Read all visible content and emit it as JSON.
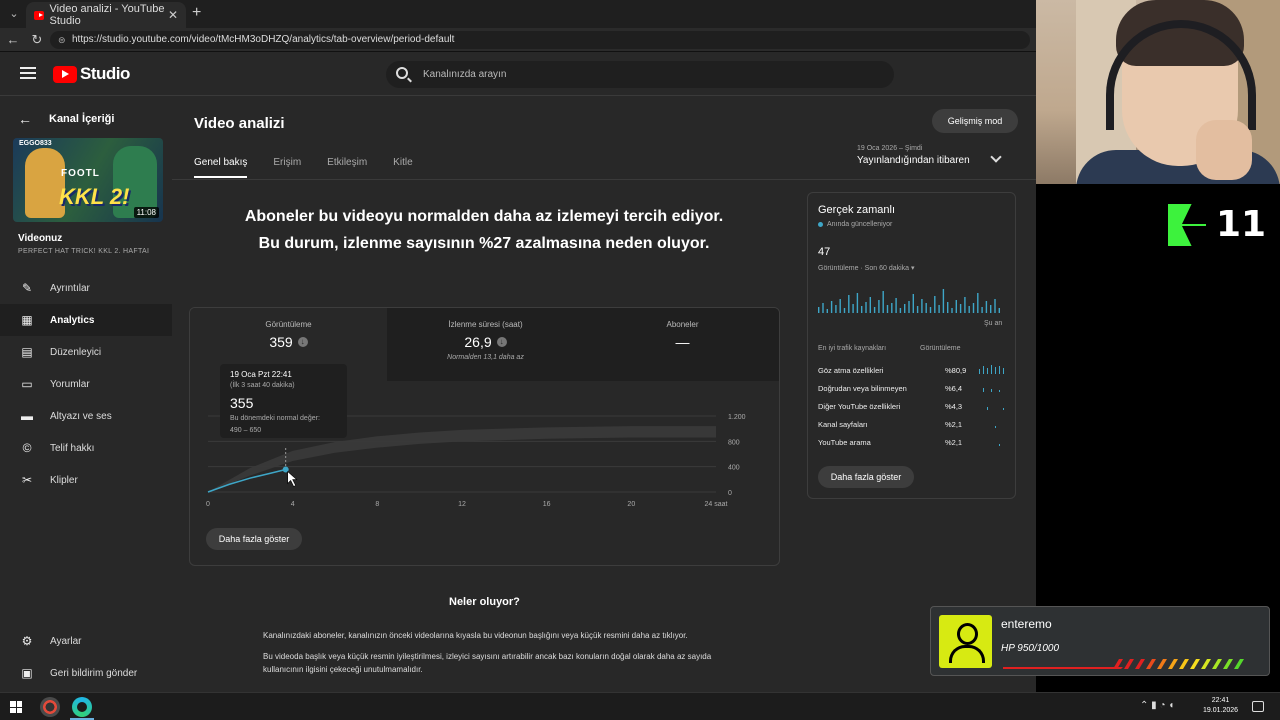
{
  "browser": {
    "tab_title": "Video analizi - YouTube Studio",
    "url": "https://studio.youtube.com/video/tMcHM3oDHZQ/analytics/tab-overview/period-default"
  },
  "studio": {
    "logo_text": "Studio",
    "search_placeholder": "Kanalınızda arayın"
  },
  "sidebar": {
    "back_label": "Kanal İçeriği",
    "thumb_duration": "11:08",
    "thumb_text": "KKL 2!",
    "thumb_top_text": "FOOTL",
    "thumb_badge": "EGGO833",
    "video_label": "Videonuz",
    "video_title": "PERFECT HAT TRICK! KKL 2. HAFTAI",
    "items": [
      {
        "label": "Ayrıntılar",
        "icon": "pencil-icon"
      },
      {
        "label": "Analytics",
        "icon": "analytics-icon"
      },
      {
        "label": "Düzenleyici",
        "icon": "editor-icon"
      },
      {
        "label": "Yorumlar",
        "icon": "comments-icon"
      },
      {
        "label": "Altyazı ve ses",
        "icon": "subtitles-icon"
      },
      {
        "label": "Telif hakkı",
        "icon": "copyright-icon"
      },
      {
        "label": "Klipler",
        "icon": "scissors-icon"
      }
    ],
    "bottom_items": [
      {
        "label": "Ayarlar",
        "icon": "gear-icon"
      },
      {
        "label": "Geri bildirim gönder",
        "icon": "feedback-icon"
      }
    ]
  },
  "main": {
    "title": "Video analizi",
    "advanced_button": "Gelişmiş mod",
    "tabs": [
      "Genel bakış",
      "Erişim",
      "Etkileşim",
      "Kitle"
    ],
    "period_date": "19 Oca 2026 – Şimdi",
    "period_label": "Yayınlandığından itibaren",
    "headline": "Aboneler bu videoyu normalden daha az izlemeyi tercih ediyor. Bu durum, izlenme sayısının %27 azalmasına neden oluyor.",
    "metrics": [
      {
        "label": "Görüntüleme",
        "value": "359",
        "sub": ""
      },
      {
        "label": "İzlenme süresi (saat)",
        "value": "26,9",
        "sub": "Normalden 13,1 daha az"
      },
      {
        "label": "Aboneler",
        "value": "—",
        "sub": ""
      }
    ],
    "tooltip": {
      "date": "19 Oca Pzt 22:41",
      "sub": "(İlk 3 saat 40 dakika)",
      "value": "355",
      "note": "Bu dönemdeki normal değer:",
      "range": "490 – 650"
    },
    "more_button": "Daha fazla göster",
    "whats_title": "Neler oluyor?",
    "para1": "Kanalınızdaki aboneler, kanalınızın önceki videolarına kıyasla bu videonun başlığını veya küçük resmini daha az tıklıyor.",
    "para2": "Bu videoda başlık veya küçük resmin iyileştirilmesi, izleyici sayısını artırabilir ancak bazı konuların doğal olarak daha az sayıda kullanıcının ilgisini çekeceği unutulmamalıdır."
  },
  "chart_data": {
    "type": "line",
    "x_ticks": [
      "0",
      "4",
      "8",
      "12",
      "16",
      "20",
      "24 saat"
    ],
    "y_ticks": [
      "0",
      "400",
      "800",
      "1.200"
    ],
    "ylim": [
      0,
      1200
    ],
    "xlim": [
      0,
      24
    ],
    "series": [
      {
        "values_x": [
          0,
          1,
          2,
          3,
          3.67
        ],
        "values_y": [
          0,
          120,
          220,
          300,
          355
        ]
      }
    ],
    "band": {
      "x": [
        0,
        2,
        4,
        6,
        8,
        10,
        12,
        14,
        16,
        18,
        20,
        22,
        24
      ],
      "low": [
        0,
        260,
        490,
        620,
        700,
        760,
        800,
        820,
        840,
        850,
        860,
        860,
        860
      ],
      "high": [
        0,
        380,
        650,
        790,
        880,
        940,
        980,
        1000,
        1020,
        1030,
        1040,
        1040,
        1040
      ]
    }
  },
  "realtime": {
    "title": "Gerçek zamanlı",
    "live_label": "Anında güncelleniyor",
    "count": "47",
    "count_label": "Görüntüleme · Son 60 dakika",
    "now_label": "Şu an",
    "table_header_source": "En iyi trafik kaynakları",
    "table_header_views": "Görüntüleme",
    "rows": [
      {
        "source": "Göz atma özellikleri",
        "pct": "%80,9"
      },
      {
        "source": "Doğrudan veya bilinmeyen",
        "pct": "%6,4"
      },
      {
        "source": "Diğer YouTube özellikleri",
        "pct": "%4,3"
      },
      {
        "source": "Kanal sayfaları",
        "pct": "%2,1"
      },
      {
        "source": "YouTube arama",
        "pct": "%2,1"
      }
    ],
    "more_button": "Daha fazla göster"
  },
  "overlay": {
    "brand_text": "11",
    "player_name": "enteremo",
    "player_hp": "HP 950/1000",
    "hp_fraction": 0.95
  },
  "taskbar": {
    "time": "22:41",
    "date": "19.01.2026"
  },
  "colors": {
    "accent_line": "#3ea6c7",
    "youtube_red": "#ff0000",
    "brand_green": "#3df23d"
  }
}
